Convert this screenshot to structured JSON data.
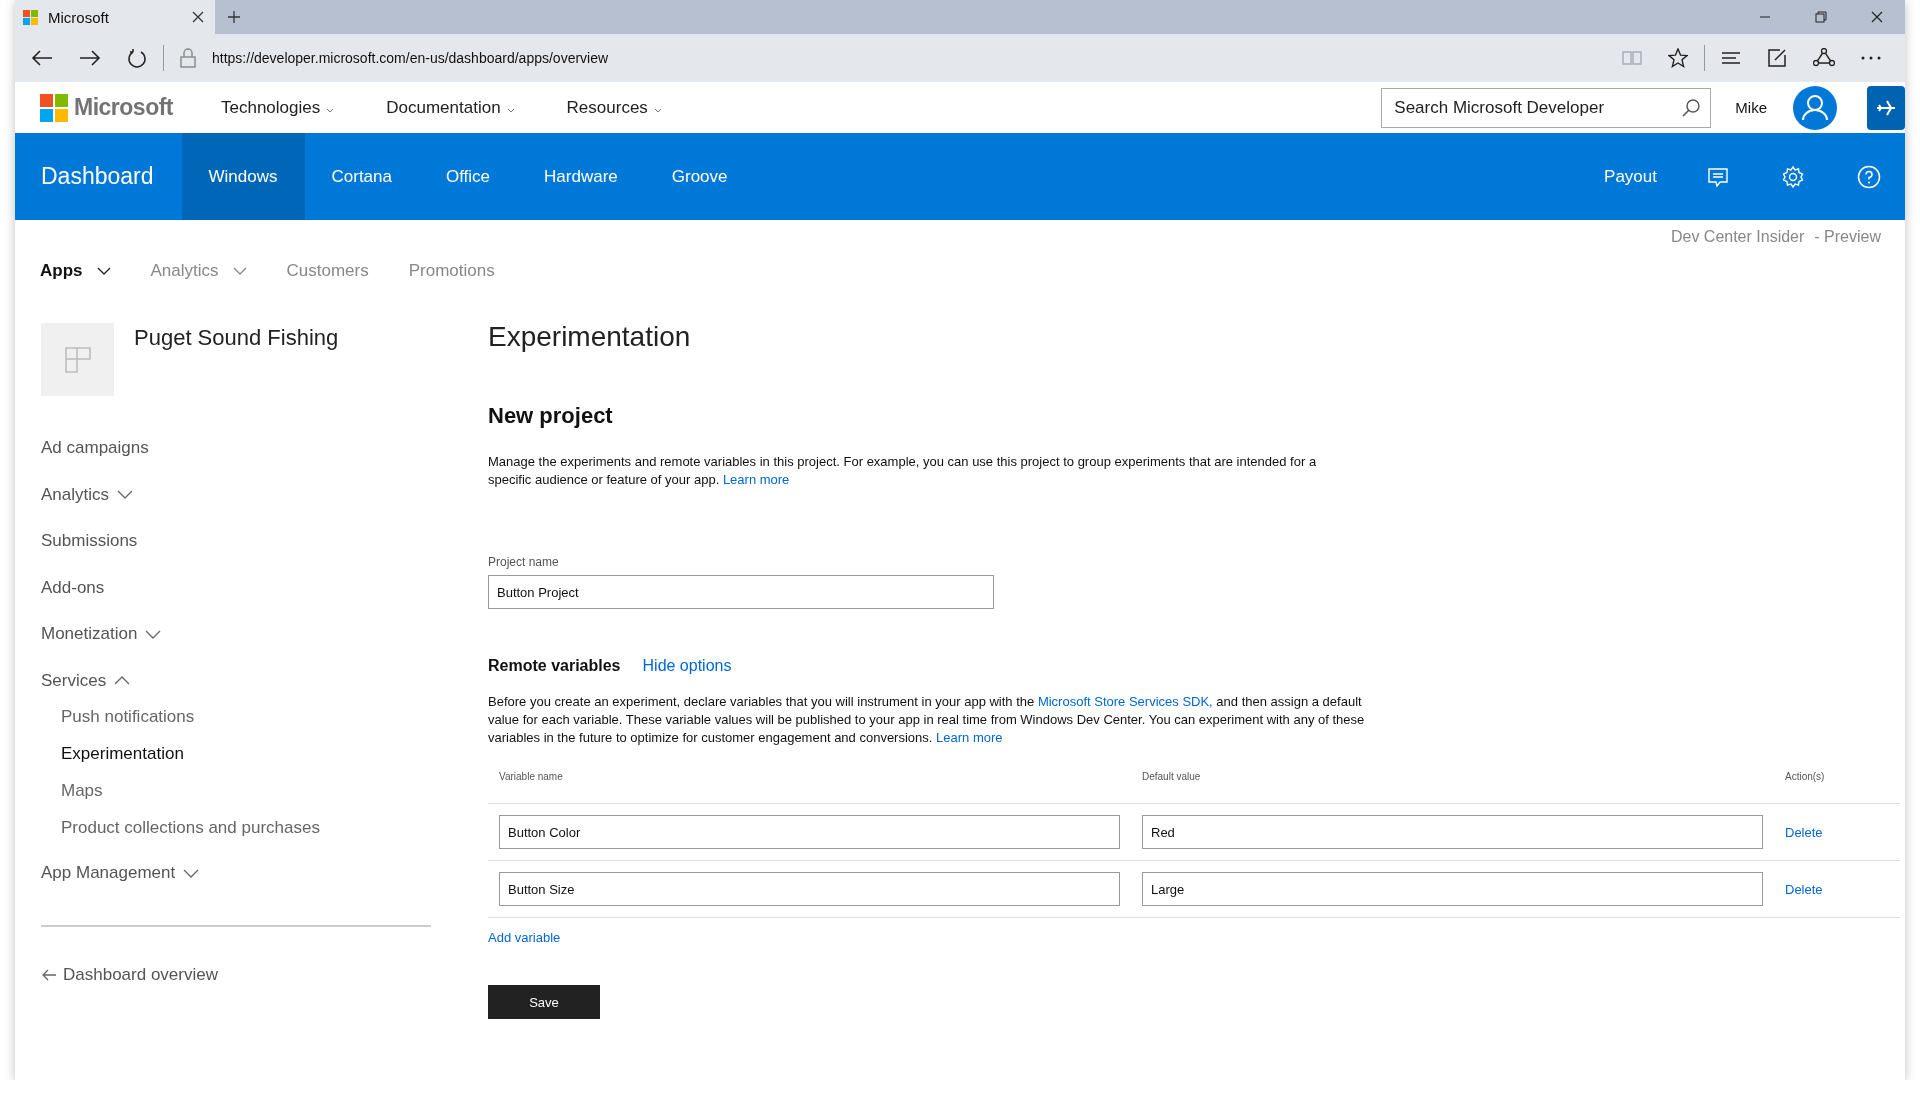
{
  "browser": {
    "tab_title": "Microsoft",
    "url": "https://developer.microsoft.com/en-us/dashboard/apps/overview"
  },
  "site_header": {
    "logo": "Microsoft",
    "menus": [
      "Technologies",
      "Documentation",
      "Resources"
    ],
    "search": {
      "placeholder": "Search Microsoft Developer"
    },
    "user": "Mike"
  },
  "dashboard_nav": {
    "title": "Dashboard",
    "tabs": [
      {
        "label": "Windows",
        "selected": true
      },
      {
        "label": "Cortana",
        "selected": false
      },
      {
        "label": "Office",
        "selected": false
      },
      {
        "label": "Hardware",
        "selected": false
      },
      {
        "label": "Groove",
        "selected": false
      }
    ],
    "payout": "Payout"
  },
  "insider": {
    "label": "Dev Center Insider",
    "suffix": "- Preview"
  },
  "subnav": [
    {
      "label": "Apps",
      "kind": "menu",
      "selected": true
    },
    {
      "label": "Analytics",
      "kind": "menu",
      "selected": false
    },
    {
      "label": "Customers",
      "kind": "link",
      "selected": false
    },
    {
      "label": "Promotions",
      "kind": "link",
      "selected": false
    }
  ],
  "sidebar": {
    "app_name": "Puget Sound Fishing",
    "items": [
      {
        "label": "Ad campaigns",
        "kind": "link"
      },
      {
        "label": "Analytics",
        "kind": "group",
        "expanded": false
      },
      {
        "label": "Submissions",
        "kind": "link"
      },
      {
        "label": "Add-ons",
        "kind": "link"
      },
      {
        "label": "Monetization",
        "kind": "group",
        "expanded": false
      },
      {
        "label": "Services",
        "kind": "group",
        "expanded": true,
        "children": [
          {
            "label": "Push notifications",
            "selected": false
          },
          {
            "label": "Experimentation",
            "selected": true
          },
          {
            "label": "Maps",
            "selected": false
          },
          {
            "label": "Product collections and purchases",
            "selected": false
          }
        ]
      },
      {
        "label": "App Management",
        "kind": "group",
        "expanded": false
      }
    ],
    "back_link": "Dashboard overview"
  },
  "main": {
    "title": "Experimentation",
    "section_title": "New project",
    "intro": "Manage the experiments and remote variables in this project. For example, you can use this project to group experiments that are intended for a specific audience or feature of your app.",
    "intro_link": "Learn more",
    "project_name": {
      "label": "Project name",
      "value": "Button Project"
    },
    "remote_variables": {
      "title": "Remote variables",
      "toggle": "Hide options",
      "text_before": "Before you create an experiment, declare variables that you will instrument in your app with the",
      "sdk_link": "Microsoft Store Services SDK,",
      "text_after": "and then assign a default value for each variable. These variable values will be published to your app in real time from Windows Dev Center. You can experiment with any of these variables in the future to optimize for customer engagement and conversions.",
      "learn_more": "Learn more",
      "columns": [
        "Variable name",
        "Default value",
        "Action(s)"
      ],
      "rows": [
        {
          "name": "Button Color",
          "value": "Red",
          "action": "Delete"
        },
        {
          "name": "Button Size",
          "value": "Large",
          "action": "Delete"
        }
      ],
      "add": "Add variable"
    },
    "save": "Save"
  }
}
